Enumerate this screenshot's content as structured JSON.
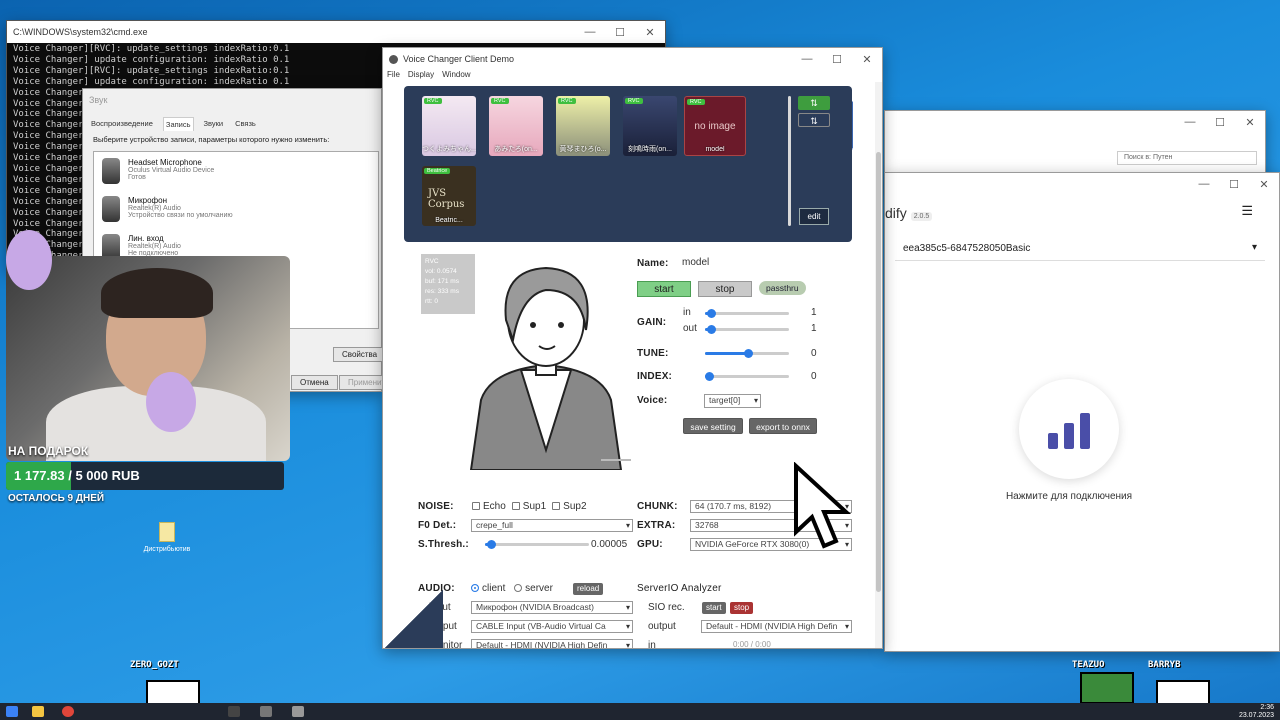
{
  "console": {
    "title": "C:\\WINDOWS\\system32\\cmd.exe",
    "lines": [
      "Voice Changer][RVC]: update_settings indexRatio:0.1",
      "Voice Changer] update configuration: indexRatio 0.1",
      "Voice Changer][RVC]: update_settings indexRatio:0.1",
      "Voice Changer] update configuration: indexRatio 0.1",
      "Voice Changer][RVC]: update_settings indexRatio:0",
      "Voice Changer] update configuration: indexRatio 0",
      "Voice Changer][RVC]: update_settings indexRatio:0",
      "Voice Changer] update configuration: indexRatio:0",
      "Voice Changer",
      "Voice Changer",
      "Voice Changer",
      "Voice Changer",
      "Voice Changer",
      "Voice Changer",
      "Voice Changer",
      "Voice Changer",
      "Voice Changer",
      "Voice Changer",
      "Voice Changer",
      "Voice Changer"
    ]
  },
  "sound": {
    "title": "Звук",
    "tabs": [
      "Воспроизведение",
      "Запись",
      "Звуки",
      "Связь"
    ],
    "hint": "Выберите устройство записи, параметры которого нужно изменить:",
    "devices": [
      {
        "name": "Headset Microphone",
        "driver": "Oculus Virtual Audio Device",
        "status": "Готов"
      },
      {
        "name": "Микрофон",
        "driver": "Realtek(R) Audio",
        "status": "Устройство связи по умолчанию"
      },
      {
        "name": "Лин. вход",
        "driver": "Realtek(R) Audio",
        "status": "Не подключено"
      }
    ],
    "properties": "Свойства",
    "cancel": "Отмена",
    "apply": "Применить"
  },
  "stream": {
    "donate_title": "НА ПОДАРОК",
    "donate_amount": "1 177.83 / 5 000 RUB",
    "donate_fraction": 0.235,
    "donate_left": "ОСТАЛОСЬ 9 ДНЕЙ",
    "desktop_icon": "Дистрибьютив",
    "user_left": "ZERO_GOZT",
    "user_mid": "TEAZUO",
    "user_right": "BARRYB"
  },
  "explorer": {
    "search": "Поиск в: Путен"
  },
  "modify": {
    "brand": "dify",
    "version": "2.0.5",
    "device": "eea385c5-6847528050Basic",
    "connect": "Нажмите для подключения"
  },
  "vc": {
    "title": "Voice Changer Client Demo",
    "menu": [
      "File",
      "Display",
      "Window"
    ],
    "models": [
      {
        "tag": "RVC",
        "caption": "つくよみちゃん..."
      },
      {
        "tag": "RVC",
        "caption": "あみたろ(on..."
      },
      {
        "tag": "RVC",
        "caption": "黄琴まひろ(o..."
      },
      {
        "tag": "RVC",
        "caption": "刻鳴時雨(on..."
      },
      {
        "tag": "RVC",
        "caption": "model",
        "noimage": "no image"
      },
      {
        "tag": "Beatrice",
        "caption": "Beatric...",
        "art": "JVS Corpus"
      }
    ],
    "edit": "edit",
    "sort_up": "⇅",
    "monitor": [
      "RVC",
      "vol: 0.0574",
      "buf: 171 ms",
      "res: 333 ms",
      "rtt: 0"
    ],
    "name_label": "Name:",
    "name_value": "model",
    "start": "start",
    "stop": "stop",
    "passthru": "passthru",
    "gain_label": "GAIN:",
    "gain_in_label": "in",
    "gain_out_label": "out",
    "gain_in": "1",
    "gain_out": "1",
    "tune_label": "TUNE:",
    "tune": "0",
    "index_label": "INDEX:",
    "index": "0",
    "voice_label": "Voice:",
    "voice": "target[0]",
    "save_setting": "save setting",
    "export_onnx": "export to onnx",
    "noise_label": "NOISE:",
    "echo": "Echo",
    "sup1": "Sup1",
    "sup2": "Sup2",
    "chunk_label": "CHUNK:",
    "chunk": "64 (170.7 ms, 8192)",
    "f0_label": "F0 Det.:",
    "f0": "crepe_full",
    "extra_label": "EXTRA:",
    "extra": "32768",
    "sthresh_label": "S.Thresh.:",
    "sthresh": "0.00005",
    "gpu_label": "GPU:",
    "gpu": "NVIDIA GeForce RTX 3080(0)",
    "audio_label": "AUDIO:",
    "client": "client",
    "server": "server",
    "reload": "reload",
    "analyzer": "ServerIO Analyzer",
    "input_label": "input",
    "input": "Микрофон (NVIDIA Broadcast)",
    "sio_label": "SIO rec.",
    "sio_start": "start",
    "sio_stop": "stop",
    "output_label": "output",
    "output": "CABLE Input (VB-Audio Virtual Ca",
    "output2_label": "output",
    "output2": "Default - HDMI (NVIDIA High Defin",
    "monitor_label": "monitor",
    "monitor_dev": "Default - HDMI (NVIDIA High Defin",
    "in_label": "in",
    "time": "0:00 / 0:00"
  },
  "taskbar": {
    "time": "2:36",
    "date": "23.07.2023"
  }
}
